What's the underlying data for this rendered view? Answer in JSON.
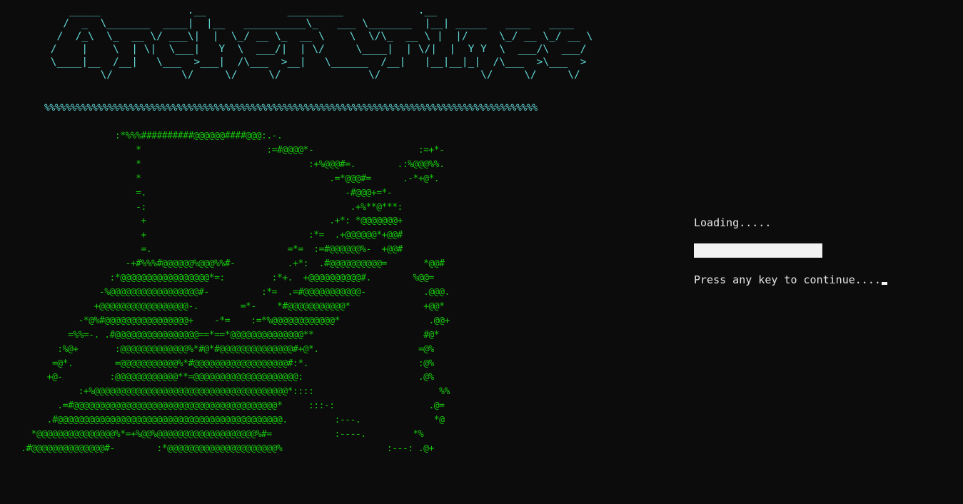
{
  "terminal": {
    "colors": {
      "background": "#0c0c0c",
      "banner": "#61d6d6",
      "art": "#16c60c",
      "text": "#e6e6e6",
      "progress_fill": "#f2f2f2"
    },
    "banner_ascii": "    _____              .__             _________            .__                     \n   /  _  \\_______  ____|  |__   __________\\_   ___ \\_______  |__| _____   ____   ____  \n  /  /_\\  \\_  __ \\/ ___\\|  |  \\_/ __ \\_  __ \\    \\  \\/\\_  __ \\ |  |/     \\_/ __ \\_/ __ \\ \n /    |    \\  | \\|  \\___|   Y  \\  ___/|  | \\/     \\____|  | \\/|  |  Y Y  \\  ___/\\  ___/ \n \\____|__  /__|   \\___  >___|  /\\___  >__|   \\______  /__|   |__|__|_|  /\\___  >\\___  >\n         \\/           \\/     \\/     \\/              \\/                \\/     \\/     \\/ ",
    "divider": "%%%%%%%%%%%%%%%%%%%%%%%%%%%%%%%%%%%%%%%%%%%%%%%%%%%%%%%%%%%%%%%%%%%%%%%%%%%%%%%%%%%%%%%%%%%%%",
    "art_ascii": "                  :*%%%##########@@@@@@####@@@:.-.\n                      *                        :=#@@@@*-                    :=+*-\n                      *                                :+%@@@#=.        .:%@@@%%.\n                      *                                    .=*@@@#=      .-*+@*.\n                      =.                                      -#@@@+=*-\n                      -:                                       .+%**@***:\n                       +                                   .+*: *@@@@@@@+\n                       +                               :*=  .+@@@@@@*+@@#\n                       =.                          =*=  :=#@@@@@@%-  +@@#\n                    -+#%%%#@@@@@@%@@@%%#-          .+*:  .#@@@@@@@@@@=       *@@#\n                 :*@@@@@@@@@@@@@@@@@*=:         :*+.  +@@@@@@@@@@#.        %@@=\n               -%@@@@@@@@@@@@@@@@@#-          :*=  .=#@@@@@@@@@@@-           .@@@.\n              +@@@@@@@@@@@@@@@@@-.        =*-    *#@@@@@@@@@@@*              +@@*\n           -*@%#@@@@@@@@@@@@@@@@+    -*=    :=*%@@@@@@@@@@@@*                 .@@+\n         =%%=-. .#@@@@@@@@@@@@@@@@==*==*@@@@@@@@@@@@@@**                     #@*\n       :%@+       :@@@@@@@@@@@@@%*#@*#@@@@@@@@@@@@@@#+@*.                   =@%\n      =@*.        =@@@@@@@@@@@%*#@@@@@@@@@@@@@@@@@@#:*.                     :@%\n     +@-         :@@@@@@@@@@@@**=@@@@@@@@@@@@@@@@@@@@:                      .@%\n           :+%@@@@@@@@@@@@@@@@@@@@@@@@@@@@@@@@@@@@@*::::                        %%\n       .=#@@@@@@@@@@@@@@@@@@@@@@@@@@@@@@@@@@@@@@@*     :::-:                  .@=\n     .#@@@@@@@@@@@@@@@@@@@@@@@@@@@@@@@@@@@@@@@@@@@.         :---.              *@\n  *@@@@@@@@@@@@@@@%*=+%@@%@@@@@@@@@@@@@@@@@@@%#=            :----.         *%\n.#@@@@@@@@@@@@@@#-        :*@@@@@@@@@@@@@@@@@@@@@%                    :---: .@+",
    "loading_label": "Loading.....",
    "progress": 1.0,
    "prompt": "Press any key to continue...."
  }
}
